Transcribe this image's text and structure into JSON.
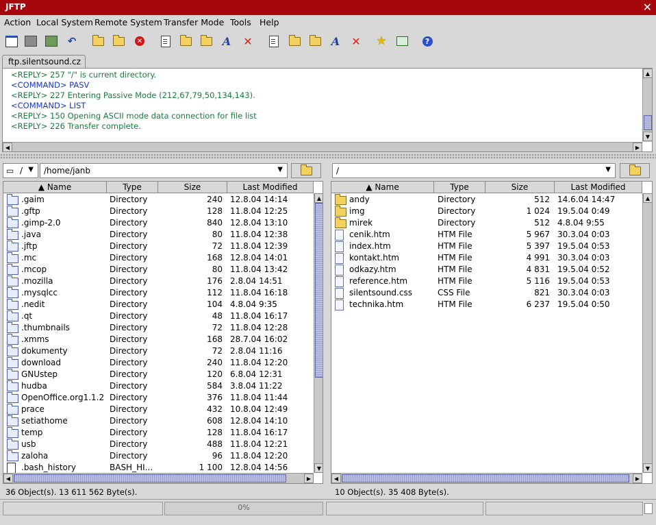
{
  "window": {
    "title": "JFTP"
  },
  "menu": [
    "Action",
    "Local System",
    "Remote System",
    "Transfer Mode",
    "Tools",
    "Help"
  ],
  "toolbar_icons": [
    "connect-icon",
    "disconnect-icon",
    "network-icon",
    "reconnect-icon",
    "local-new-folder-icon",
    "local-upload-icon",
    "stop-icon",
    "local-new-file-icon",
    "local-open-folder-icon",
    "local-browse-icon",
    "local-rename-icon",
    "local-delete-icon",
    "remote-new-file-icon",
    "remote-new-folder-icon",
    "remote-open-folder-icon",
    "remote-rename-icon",
    "remote-delete-icon",
    "bookmark-icon",
    "console-icon",
    "help-icon"
  ],
  "tab": {
    "label": "ftp.silentsound.cz"
  },
  "log": [
    {
      "type": "reply",
      "text": "<REPLY> 257 \"/\" is current directory."
    },
    {
      "type": "command",
      "text": "<COMMAND> PASV"
    },
    {
      "type": "reply",
      "text": "<REPLY> 227 Entering Passive Mode (212,67,79,50,134,143)."
    },
    {
      "type": "command",
      "text": "<COMMAND> LIST"
    },
    {
      "type": "reply",
      "text": "<REPLY> 150 Opening ASCII mode data connection for file list"
    },
    {
      "type": "reply",
      "text": "<REPLY> 226 Transfer complete."
    }
  ],
  "local": {
    "drive": "/",
    "path": "/home/janb",
    "columns": [
      "Name",
      "Type",
      "Size",
      "Last Modified"
    ],
    "files": [
      {
        "icon": "dir",
        "name": ".gaim",
        "type": "Directory",
        "size": "240",
        "modified": "12.8.04 14:14"
      },
      {
        "icon": "dir",
        "name": ".gftp",
        "type": "Directory",
        "size": "128",
        "modified": "11.8.04 12:25"
      },
      {
        "icon": "dir",
        "name": ".gimp-2.0",
        "type": "Directory",
        "size": "840",
        "modified": "12.8.04 13:10"
      },
      {
        "icon": "dir",
        "name": ".java",
        "type": "Directory",
        "size": "80",
        "modified": "11.8.04 12:38"
      },
      {
        "icon": "dir",
        "name": ".jftp",
        "type": "Directory",
        "size": "72",
        "modified": "11.8.04 12:39"
      },
      {
        "icon": "dir",
        "name": ".mc",
        "type": "Directory",
        "size": "168",
        "modified": "12.8.04 14:01"
      },
      {
        "icon": "dir",
        "name": ".mcop",
        "type": "Directory",
        "size": "80",
        "modified": "11.8.04 13:42"
      },
      {
        "icon": "dir",
        "name": ".mozilla",
        "type": "Directory",
        "size": "176",
        "modified": "2.8.04 14:51"
      },
      {
        "icon": "dir",
        "name": ".mysqlcc",
        "type": "Directory",
        "size": "112",
        "modified": "11.8.04 16:18"
      },
      {
        "icon": "dir",
        "name": ".nedit",
        "type": "Directory",
        "size": "104",
        "modified": "4.8.04 9:35"
      },
      {
        "icon": "dir",
        "name": ".qt",
        "type": "Directory",
        "size": "48",
        "modified": "11.8.04 16:17"
      },
      {
        "icon": "dir",
        "name": ".thumbnails",
        "type": "Directory",
        "size": "72",
        "modified": "11.8.04 12:28"
      },
      {
        "icon": "dir",
        "name": ".xmms",
        "type": "Directory",
        "size": "168",
        "modified": "28.7.04 16:02"
      },
      {
        "icon": "dir",
        "name": "dokumenty",
        "type": "Directory",
        "size": "72",
        "modified": "2.8.04 11:16"
      },
      {
        "icon": "dir",
        "name": "download",
        "type": "Directory",
        "size": "240",
        "modified": "11.8.04 12:20"
      },
      {
        "icon": "dir",
        "name": "GNUstep",
        "type": "Directory",
        "size": "120",
        "modified": "6.8.04 12:31"
      },
      {
        "icon": "dir",
        "name": "hudba",
        "type": "Directory",
        "size": "584",
        "modified": "3.8.04 11:22"
      },
      {
        "icon": "dir",
        "name": "OpenOffice.org1.1.2",
        "type": "Directory",
        "size": "376",
        "modified": "11.8.04 11:44"
      },
      {
        "icon": "dir",
        "name": "prace",
        "type": "Directory",
        "size": "432",
        "modified": "10.8.04 12:49"
      },
      {
        "icon": "dir",
        "name": "setiathome",
        "type": "Directory",
        "size": "608",
        "modified": "12.8.04 14:10"
      },
      {
        "icon": "dir",
        "name": "temp",
        "type": "Directory",
        "size": "128",
        "modified": "11.8.04 16:17"
      },
      {
        "icon": "dir",
        "name": "usb",
        "type": "Directory",
        "size": "488",
        "modified": "11.8.04 12:21"
      },
      {
        "icon": "dir",
        "name": "zaloha",
        "type": "Directory",
        "size": "96",
        "modified": "11.8.04 12:20"
      },
      {
        "icon": "plain",
        "name": ".bash_history",
        "type": "BASH_HI...",
        "size": "1 100",
        "modified": "12.8.04 14:56"
      }
    ],
    "status": "36 Object(s). 13 611 562 Byte(s)."
  },
  "remote": {
    "path": "/",
    "columns": [
      "Name",
      "Type",
      "Size",
      "Last Modified"
    ],
    "files": [
      {
        "icon": "ydir",
        "name": "andy",
        "type": "Directory",
        "size": "512",
        "modified": "14.6.04 14:47"
      },
      {
        "icon": "ydir",
        "name": "img",
        "type": "Directory",
        "size": "1 024",
        "modified": "19.5.04 0:49"
      },
      {
        "icon": "ydir",
        "name": "mirek",
        "type": "Directory",
        "size": "512",
        "modified": "4.8.04 9:55"
      },
      {
        "icon": "file",
        "name": "cenik.htm",
        "type": "HTM File",
        "size": "5 967",
        "modified": "30.3.04 0:03"
      },
      {
        "icon": "file",
        "name": "index.htm",
        "type": "HTM File",
        "size": "5 397",
        "modified": "19.5.04 0:53"
      },
      {
        "icon": "file",
        "name": "kontakt.htm",
        "type": "HTM File",
        "size": "4 991",
        "modified": "30.3.04 0:03"
      },
      {
        "icon": "file",
        "name": "odkazy.htm",
        "type": "HTM File",
        "size": "4 831",
        "modified": "19.5.04 0:52"
      },
      {
        "icon": "file",
        "name": "reference.htm",
        "type": "HTM File",
        "size": "5 116",
        "modified": "19.5.04 0:53"
      },
      {
        "icon": "file",
        "name": "silentsound.css",
        "type": "CSS File",
        "size": "821",
        "modified": "30.3.04 0:03"
      },
      {
        "icon": "file",
        "name": "technika.htm",
        "type": "HTM File",
        "size": "6 237",
        "modified": "19.5.04 0:50"
      }
    ],
    "status": "10 Object(s). 35 408 Byte(s)."
  },
  "progress": {
    "label": "0%",
    "value": 0
  },
  "colors": {
    "titlebar": "#a6070d",
    "command": "#1a36c0",
    "reply": "#197a3e"
  }
}
